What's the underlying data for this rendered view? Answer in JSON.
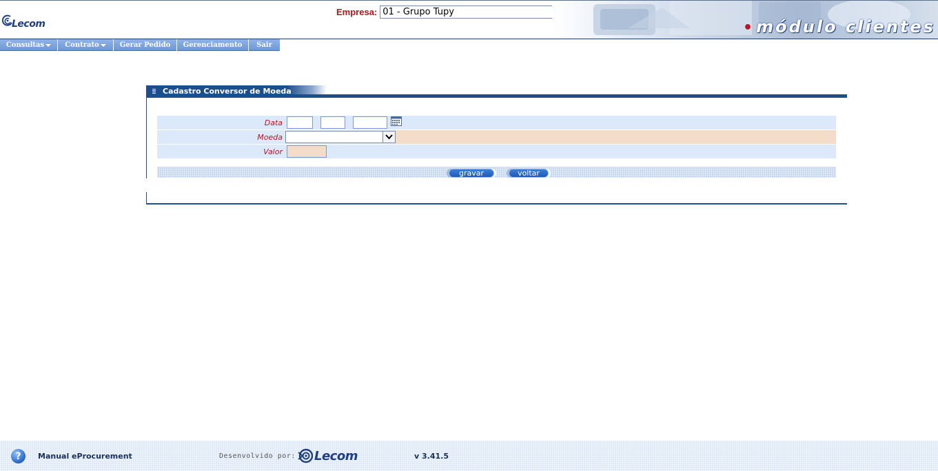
{
  "header": {
    "logo_text": "Lecom",
    "empresa_label": "Empresa:",
    "empresa_value": "01 - Grupo Tupy",
    "banner_title": "módulo clientes",
    "banner_dot": "•"
  },
  "menu": {
    "items": [
      {
        "label": "Consultas",
        "has_dropdown": true
      },
      {
        "label": "Contrato",
        "has_dropdown": true
      },
      {
        "label": "Gerar Pedido",
        "has_dropdown": false
      },
      {
        "label": "Gerenciamento",
        "has_dropdown": false
      },
      {
        "label": "Sair",
        "has_dropdown": false
      }
    ]
  },
  "form": {
    "title": "Cadastro Conversor de Moeda",
    "fields": {
      "data_label": "Data",
      "data_day": "",
      "data_month": "",
      "data_year": "",
      "moeda_label": "Moeda",
      "moeda_value": "",
      "valor_label": "Valor",
      "valor_value": ""
    },
    "buttons": {
      "gravar": "gravar",
      "voltar": "voltar"
    }
  },
  "footer": {
    "help_glyph": "?",
    "manual_label": "Manual eProcurement",
    "developed_by": "Desenvolvido por:",
    "logo_text": "Lecom",
    "version": "v 3.41.5"
  },
  "colors": {
    "primary": "#1d4e8c",
    "menu": "#6f98d9",
    "label_red": "#c0131b",
    "row_blue": "#dbe9fa",
    "row_peach": "#f3dcc8"
  },
  "icons": [
    "lecom-logo-icon",
    "chevron-down-icon",
    "calendar-icon",
    "help-icon",
    "caret-down-icon"
  ]
}
